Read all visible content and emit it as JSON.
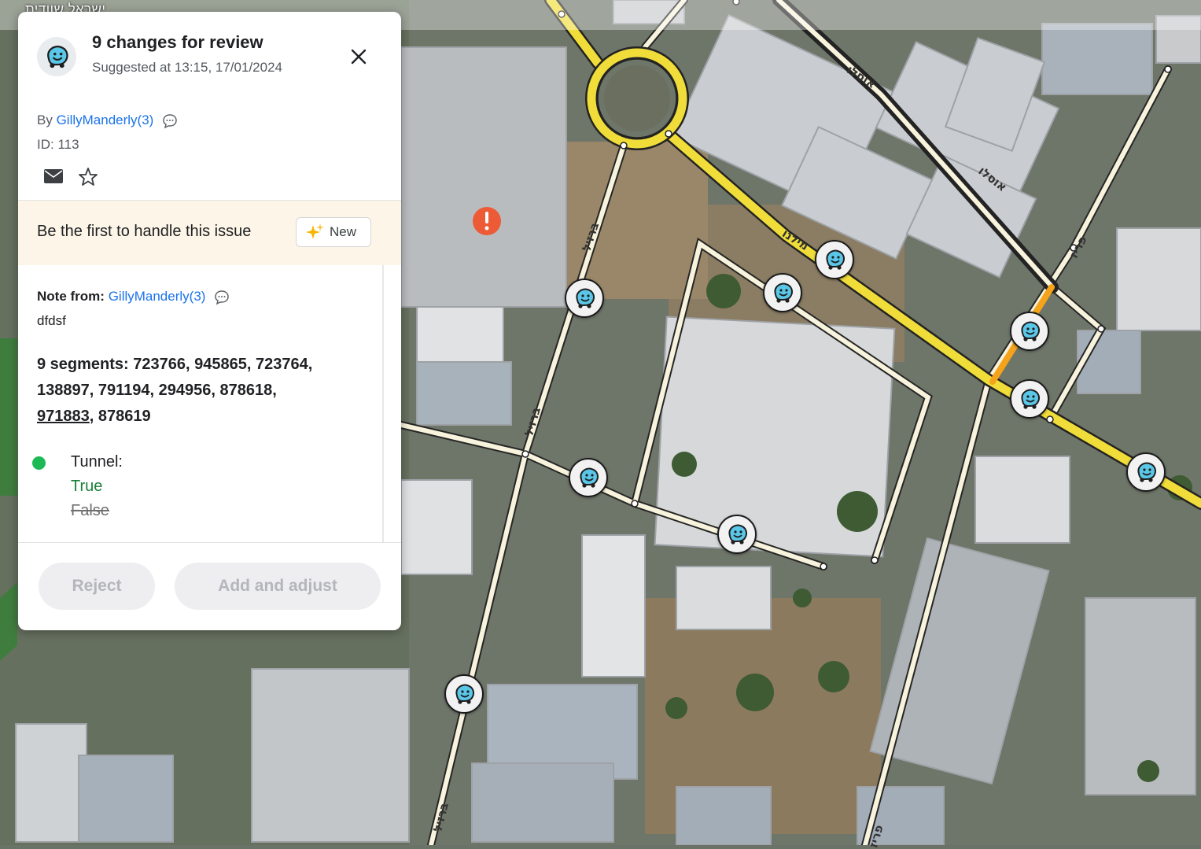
{
  "map": {
    "region_label": "ישראל  שוודית",
    "street_labels": [
      "אוסלו",
      "אוסלו",
      "פריז",
      "ברזיל",
      "ברזיל",
      "ברזיל",
      "מילנו",
      "פריז"
    ],
    "issue_marker": "alert-marker",
    "pin_icon": "waze-icon",
    "highlight_color": "#f5a31a",
    "major_road_color": "#f3e03b",
    "minor_road_color": "#fbf6df"
  },
  "panel": {
    "title": "9 changes for review",
    "subtitle": "Suggested at 13:15, 17/01/2024",
    "close_icon": "close-icon",
    "by_prefix": "By",
    "author": "GillyManderly(3)",
    "id_text": "ID: 113",
    "banner_text": "Be the first to handle this issue",
    "new_label": "New",
    "note_from_label": "Note from:",
    "note_author": "GillyManderly(3)",
    "note_text": "dfdsf",
    "segments": {
      "prefix": "9 segments: 723766, 945865, 723764, 138897, 791194, 294956, 878618,",
      "underlined": "971883",
      "suffix": ", 878619"
    },
    "change": {
      "label": "Tunnel:",
      "new_value": "True",
      "old_value": "False",
      "status_color": "#1db954"
    },
    "reject_label": "Reject",
    "add_label": "Add and adjust"
  }
}
